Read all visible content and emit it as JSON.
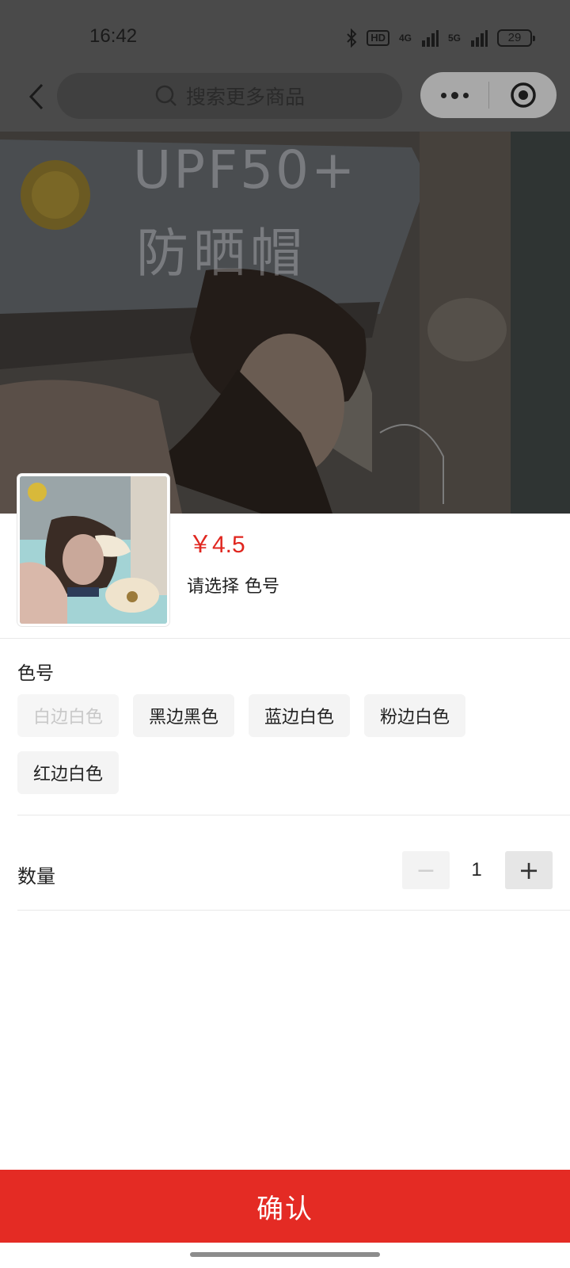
{
  "status_bar": {
    "time": "16:42",
    "hd_label": "HD",
    "net1": "4G",
    "net2": "5G",
    "battery": "29"
  },
  "nav": {
    "search_placeholder": "搜索更多商品"
  },
  "hero": {
    "overlay_line1": "UPF50+",
    "overlay_line2": "防晒帽"
  },
  "product": {
    "price": "￥4.5",
    "select_hint": "请选择 色号"
  },
  "spec": {
    "title": "色号",
    "options": [
      {
        "label": "白边白色",
        "disabled": true
      },
      {
        "label": "黑边黑色",
        "disabled": false
      },
      {
        "label": "蓝边白色",
        "disabled": false
      },
      {
        "label": "粉边白色",
        "disabled": false
      },
      {
        "label": "红边白色",
        "disabled": false
      }
    ]
  },
  "quantity": {
    "label": "数量",
    "value": "1",
    "minus": "−",
    "plus": "+"
  },
  "actions": {
    "confirm_label": "确认"
  },
  "colors": {
    "accent": "#e42b24",
    "price": "#e0261f"
  }
}
